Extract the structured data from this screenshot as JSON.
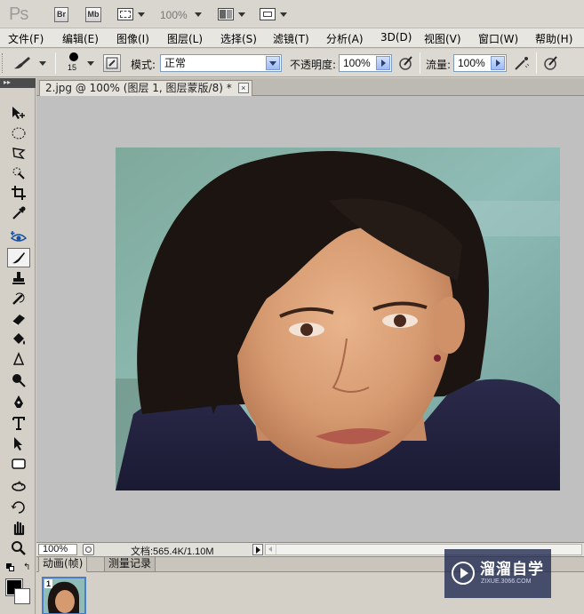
{
  "app": {
    "logo": "Ps",
    "bridge_label": "Br",
    "minibridge_label": "Mb",
    "zoom_display": "100%"
  },
  "menubar": {
    "items": [
      {
        "label": "文件(F)"
      },
      {
        "label": "编辑(E)"
      },
      {
        "label": "图像(I)"
      },
      {
        "label": "图层(L)"
      },
      {
        "label": "选择(S)"
      },
      {
        "label": "滤镜(T)"
      },
      {
        "label": "分析(A)"
      },
      {
        "label": "3D(D)"
      },
      {
        "label": "视图(V)"
      },
      {
        "label": "窗口(W)"
      },
      {
        "label": "帮助(H)"
      }
    ]
  },
  "options": {
    "brush_size": "15",
    "mode_label": "模式:",
    "mode_value": "正常",
    "opacity_label": "不透明度:",
    "opacity_value": "100%",
    "flow_label": "流量:",
    "flow_value": "100%"
  },
  "document": {
    "tab_title": "2.jpg @ 100% (图层 1, 图层蒙版/8) *",
    "close_glyph": "×",
    "status_zoom": "100%",
    "status_info": "文档:565.4K/1.10M"
  },
  "panels": {
    "tabs": [
      {
        "label": "动画(帧)"
      },
      {
        "label": "测量记录"
      }
    ],
    "frame_number": "1"
  },
  "watermark": {
    "title": "溜溜自学",
    "url": "ZIXUE.3066.COM"
  },
  "colors": {
    "foreground": "#000000",
    "background": "#ffffff",
    "canvas_bg": "#c0c0c0"
  },
  "tools": [
    {
      "icon": "move-icon"
    },
    {
      "icon": "elliptical-marquee-icon"
    },
    {
      "icon": "lasso-icon"
    },
    {
      "icon": "quick-selection-icon"
    },
    {
      "icon": "crop-icon"
    },
    {
      "icon": "eyedropper-icon"
    },
    {
      "icon": "red-eye-icon"
    },
    {
      "icon": "brush-icon"
    },
    {
      "icon": "clone-stamp-icon"
    },
    {
      "icon": "history-brush-icon"
    },
    {
      "icon": "eraser-icon"
    },
    {
      "icon": "paint-bucket-icon"
    },
    {
      "icon": "blur-icon"
    },
    {
      "icon": "dodge-icon"
    },
    {
      "icon": "pen-icon"
    },
    {
      "icon": "type-icon"
    },
    {
      "icon": "path-selection-icon"
    },
    {
      "icon": "rectangle-icon"
    },
    {
      "icon": "3d-rotate-icon"
    },
    {
      "icon": "3d-orbit-icon"
    },
    {
      "icon": "hand-icon"
    },
    {
      "icon": "zoom-icon"
    }
  ]
}
